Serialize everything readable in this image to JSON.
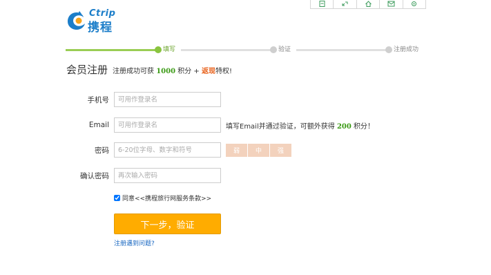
{
  "logo": {
    "en": "Ctrip",
    "cn": "携程"
  },
  "toolbar": {
    "icons": [
      "note-icon",
      "resize-icon",
      "home-icon",
      "mail-icon",
      "settings-icon"
    ]
  },
  "steps": [
    {
      "label": "填写",
      "status": "active"
    },
    {
      "label": "验证",
      "status": "pending"
    },
    {
      "label": "注册成功",
      "status": "pending"
    }
  ],
  "header": {
    "title": "会员注册",
    "promo_prefix": "注册成功可获",
    "promo_points": "1000",
    "promo_mid": "积分 +",
    "promo_cashback": "返现",
    "promo_suffix": "特权!"
  },
  "form": {
    "phone": {
      "label": "手机号",
      "placeholder": "可用作登录名",
      "value": ""
    },
    "email": {
      "label": "Email",
      "placeholder": "可用作登录名",
      "value": "",
      "hint_prefix": "填写Email并通过验证，可额外获得",
      "hint_points": "200",
      "hint_suffix": "积分！"
    },
    "password": {
      "label": "密码",
      "placeholder": "6-20位字母、数字和符号",
      "value": "",
      "strength": [
        "弱",
        "中",
        "强"
      ]
    },
    "confirm": {
      "label": "确认密码",
      "placeholder": "再次输入密码",
      "value": ""
    },
    "agree": {
      "checked": true,
      "prefix": "同意",
      "terms": "<<携程旅行网服务条款>>"
    },
    "submit_label": "下一步，验证",
    "help_link": "注册遇到问题?"
  },
  "colors": {
    "brand_blue": "#1c7ec9",
    "accent_orange": "#ffac00",
    "progress_green": "#8ac43f",
    "points_green": "#3a9a14",
    "cashback_orange": "#e8621c"
  }
}
